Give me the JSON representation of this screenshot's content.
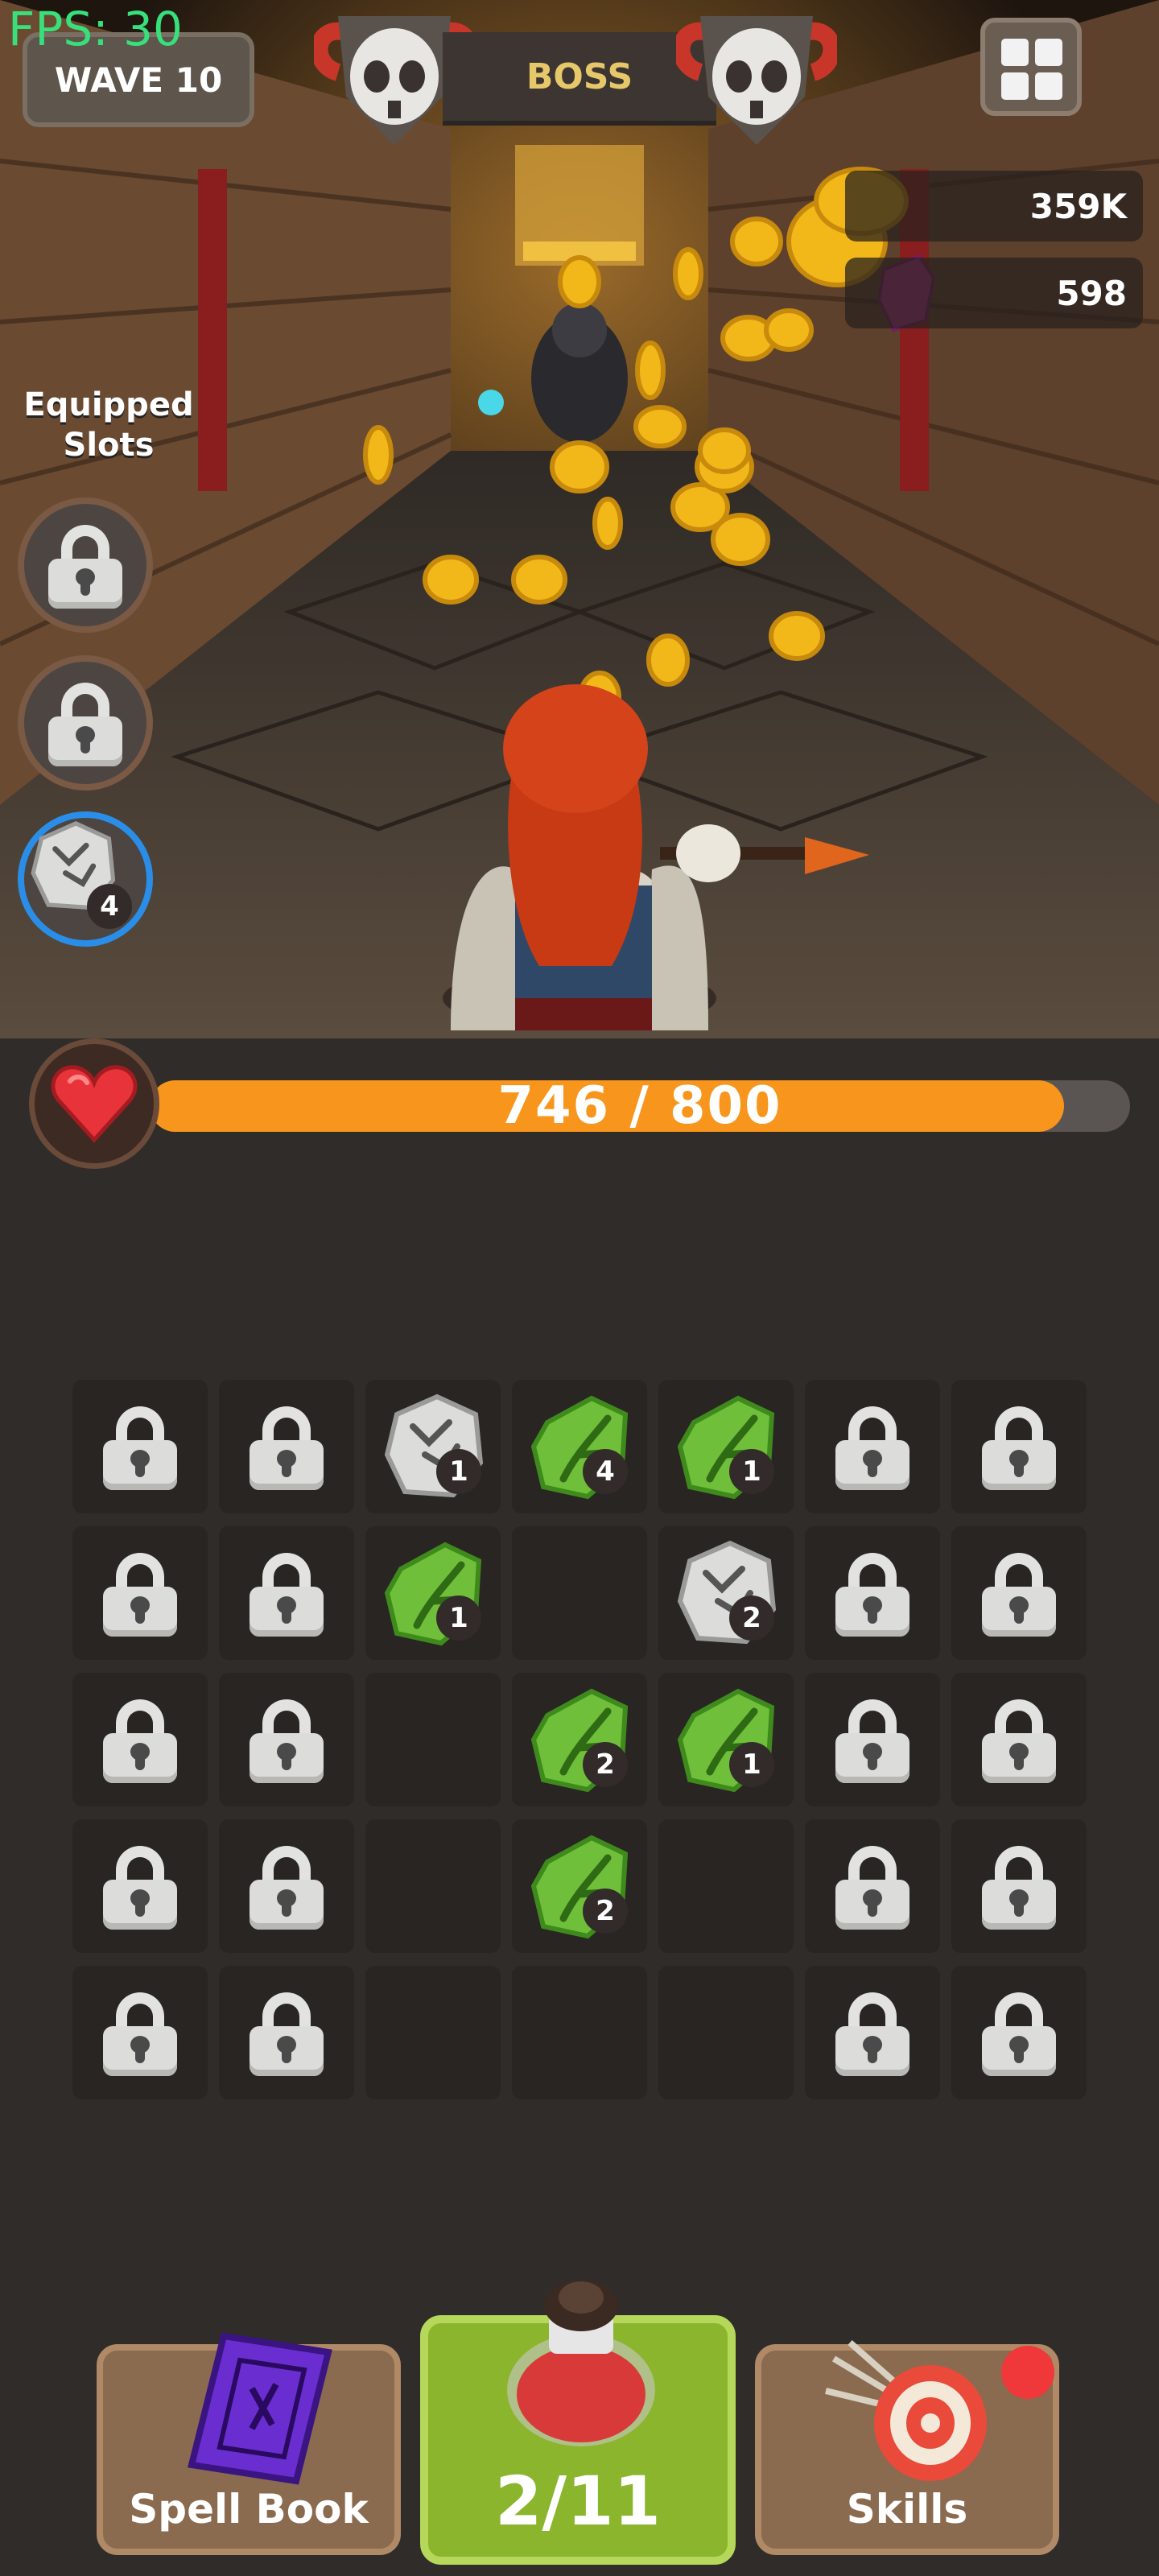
{
  "hud": {
    "fps": "FPS: 30",
    "wave_label": "WAVE 10",
    "boss_label": "BOSS",
    "resources": {
      "coins": "359K",
      "gems": "598"
    }
  },
  "equipped": {
    "label_line1": "Equipped",
    "label_line2": "Slots",
    "slots": [
      {
        "state": "locked"
      },
      {
        "state": "locked"
      },
      {
        "state": "rune",
        "rune": "stone",
        "count": "4"
      }
    ]
  },
  "health": {
    "current": 746,
    "max": 800,
    "text": "746 / 800",
    "fraction": 0.9325
  },
  "grid": {
    "rows": [
      [
        {
          "t": "lock"
        },
        {
          "t": "lock"
        },
        {
          "t": "stone",
          "n": "1"
        },
        {
          "t": "leaf",
          "n": "4"
        },
        {
          "t": "leaf",
          "n": "1"
        },
        {
          "t": "lock"
        },
        {
          "t": "lock"
        }
      ],
      [
        {
          "t": "lock"
        },
        {
          "t": "lock"
        },
        {
          "t": "leaf",
          "n": "1"
        },
        {
          "t": "empty"
        },
        {
          "t": "stone",
          "n": "2"
        },
        {
          "t": "lock"
        },
        {
          "t": "lock"
        }
      ],
      [
        {
          "t": "lock"
        },
        {
          "t": "lock"
        },
        {
          "t": "empty"
        },
        {
          "t": "leaf",
          "n": "2"
        },
        {
          "t": "leaf",
          "n": "1"
        },
        {
          "t": "lock"
        },
        {
          "t": "lock"
        }
      ],
      [
        {
          "t": "lock"
        },
        {
          "t": "lock"
        },
        {
          "t": "empty"
        },
        {
          "t": "leaf",
          "n": "2"
        },
        {
          "t": "empty"
        },
        {
          "t": "lock"
        },
        {
          "t": "lock"
        }
      ],
      [
        {
          "t": "lock"
        },
        {
          "t": "lock"
        },
        {
          "t": "empty"
        },
        {
          "t": "empty"
        },
        {
          "t": "empty"
        },
        {
          "t": "lock"
        },
        {
          "t": "lock"
        }
      ]
    ]
  },
  "bottom": {
    "spellbook_label": "Spell Book",
    "potion_label": "2/11",
    "skills_label": "Skills"
  },
  "colors": {
    "hp_fill": "#f7951c",
    "fps": "#37e07a",
    "boss": "#e6c86a",
    "leaf_rune": "#6fbf3a",
    "potion_button": "#8ab52c"
  }
}
